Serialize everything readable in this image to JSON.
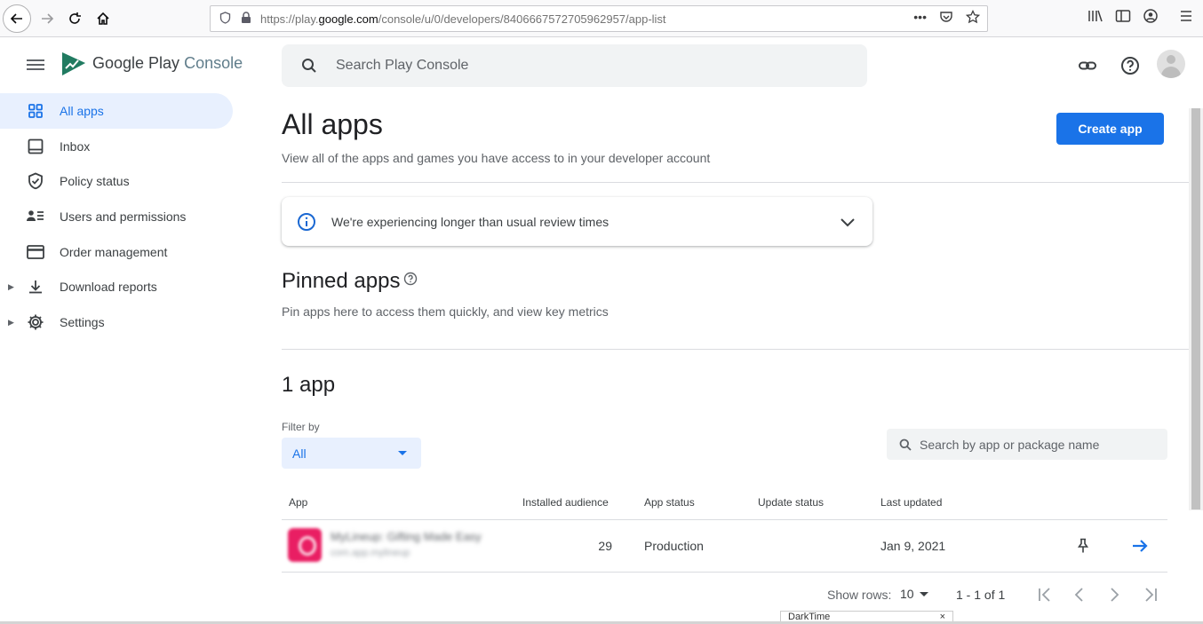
{
  "browser": {
    "url_prefix": "https://play.",
    "url_domain": "google.com",
    "url_path": "/console/u/0/developers/8406667572705962957/app-list"
  },
  "header": {
    "logo_text_brand": "Google Play",
    "logo_text_product": "Console",
    "search_placeholder": "Search Play Console"
  },
  "sidebar": {
    "items": [
      {
        "label": "All apps",
        "icon": "grid-icon",
        "active": true
      },
      {
        "label": "Inbox",
        "icon": "inbox-icon"
      },
      {
        "label": "Policy status",
        "icon": "shield-check-icon"
      },
      {
        "label": "Users and permissions",
        "icon": "users-icon"
      },
      {
        "label": "Order management",
        "icon": "credit-card-icon"
      },
      {
        "label": "Download reports",
        "icon": "download-icon",
        "expandable": true
      },
      {
        "label": "Settings",
        "icon": "gear-icon",
        "expandable": true
      }
    ]
  },
  "main": {
    "title": "All apps",
    "subtitle": "View all of the apps and games you have access to in your developer account",
    "create_button": "Create app",
    "alert_message": "We're experiencing longer than usual review times",
    "pinned_title": "Pinned apps",
    "pinned_desc": "Pin apps here to access them quickly, and view key metrics",
    "count_title": "1 app",
    "filter_label": "Filter by",
    "filter_value": "All",
    "app_search_placeholder": "Search by app or package name",
    "table": {
      "columns": [
        "App",
        "Installed audience",
        "App status",
        "Update status",
        "Last updated"
      ],
      "rows": [
        {
          "app_name": "MyLineup: Gifting Made Easy",
          "package": "com.app.mylineup",
          "installed_audience": "29",
          "app_status": "Production",
          "update_status": "",
          "last_updated": "Jan 9, 2021"
        }
      ]
    },
    "pagination": {
      "show_rows_label": "Show rows:",
      "rows_value": "10",
      "range": "1 - 1 of 1"
    }
  },
  "darktime": {
    "label": "DarkTime",
    "close": "×"
  },
  "colors": {
    "accent": "#1a73e8",
    "active_bg": "#e8f0fe",
    "app_icon": "#e91e63"
  }
}
